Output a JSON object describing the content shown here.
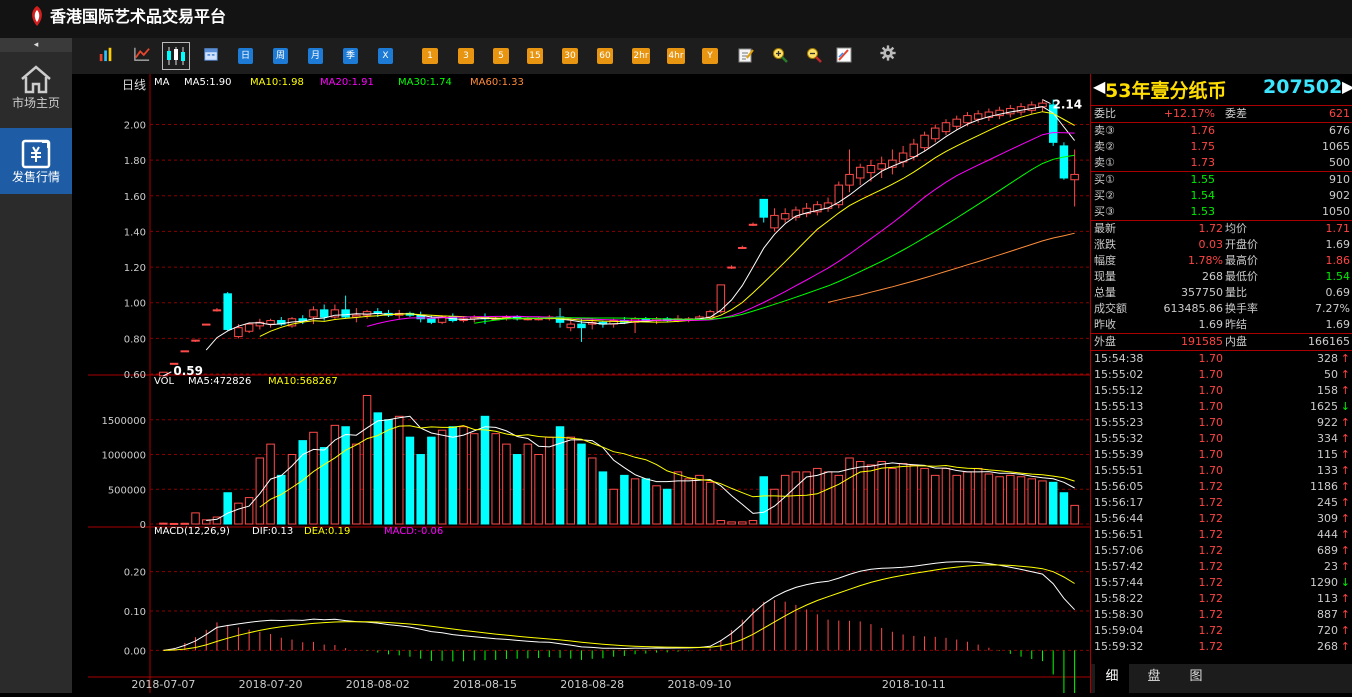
{
  "app": {
    "title": "香港国际艺术品交易平台"
  },
  "sidebar": {
    "collapse_icon": "◂",
    "items": [
      {
        "label": "市场主页",
        "icon": "home-icon"
      },
      {
        "label": "发售行情",
        "icon": "trade-icon"
      }
    ]
  },
  "toolbar": {
    "icons": [
      "bar-chart-icon",
      "line-chart-icon",
      "candlestick-icon",
      "calendar-icon"
    ],
    "periods": [
      "日",
      "周",
      "月",
      "季",
      "X"
    ],
    "minutes": [
      "1",
      "3",
      "5",
      "15",
      "30",
      "60",
      "2hr",
      "4hr",
      "Y"
    ],
    "tools": [
      "edit-icon",
      "zoom-in-icon",
      "zoom-out-icon",
      "draw-icon",
      "settings-icon"
    ]
  },
  "chart": {
    "kline_label": "日线",
    "ma_label": "MA",
    "ma": [
      {
        "label": "MA5:1.90",
        "color": "#ffffff"
      },
      {
        "label": "MA10:1.98",
        "color": "#ffff00"
      },
      {
        "label": "MA20:1.91",
        "color": "#ff00ff"
      },
      {
        "label": "MA30:1.74",
        "color": "#00ff00"
      },
      {
        "label": "MA60:1.33",
        "color": "#ff8c3a"
      }
    ],
    "vol_label": "VOL",
    "vol_ma": [
      {
        "label": "MA5:472826",
        "color": "#ffffff"
      },
      {
        "label": "MA10:568267",
        "color": "#ffff00"
      }
    ],
    "macd_label": "MACD(12,26,9)",
    "macd_items": [
      {
        "label": "DIF:0.13",
        "color": "#ffffff"
      },
      {
        "label": "DEA:0.19",
        "color": "#ffff00"
      },
      {
        "label": "MACD:-0.06",
        "color": "#ff00ff"
      }
    ],
    "price_ticks": [
      "2.00",
      "1.80",
      "1.60",
      "1.40",
      "1.20",
      "1.00",
      "0.80",
      "0.60"
    ],
    "vol_ticks": [
      "1500000",
      "1000000",
      "500000",
      "0"
    ],
    "macd_ticks": [
      "0.20",
      "0.10",
      "0.00"
    ],
    "high_label": "2.14",
    "low_label": "0.59",
    "date_labels": [
      "2018-07-07",
      "2018-07-20",
      "2018-08-02",
      "2018-08-15",
      "2018-08-28",
      "2018-09-10",
      "2018-10-11"
    ]
  },
  "chart_data": {
    "type": "candlestick",
    "title": "日线",
    "ylim": [
      0.6,
      2.16
    ],
    "candles": [
      {
        "o": 0.59,
        "h": 0.61,
        "l": 0.59,
        "c": 0.61,
        "v": 12000
      },
      {
        "o": 0.66,
        "h": 0.66,
        "l": 0.66,
        "c": 0.66,
        "v": 8000
      },
      {
        "o": 0.73,
        "h": 0.73,
        "l": 0.73,
        "c": 0.73,
        "v": 10000
      },
      {
        "o": 0.79,
        "h": 0.79,
        "l": 0.78,
        "c": 0.79,
        "v": 160000
      },
      {
        "o": 0.88,
        "h": 0.88,
        "l": 0.88,
        "c": 0.88,
        "v": 60000
      },
      {
        "o": 0.96,
        "h": 0.97,
        "l": 0.95,
        "c": 0.96,
        "v": 100000
      },
      {
        "o": 1.05,
        "h": 1.06,
        "l": 0.84,
        "c": 0.85,
        "v": 450000
      },
      {
        "o": 0.81,
        "h": 0.88,
        "l": 0.8,
        "c": 0.86,
        "v": 300000
      },
      {
        "o": 0.84,
        "h": 0.89,
        "l": 0.83,
        "c": 0.88,
        "v": 380000
      },
      {
        "o": 0.87,
        "h": 0.91,
        "l": 0.85,
        "c": 0.89,
        "v": 950000
      },
      {
        "o": 0.88,
        "h": 0.91,
        "l": 0.86,
        "c": 0.9,
        "v": 1150000
      },
      {
        "o": 0.9,
        "h": 0.92,
        "l": 0.87,
        "c": 0.88,
        "v": 700000
      },
      {
        "o": 0.87,
        "h": 0.92,
        "l": 0.86,
        "c": 0.91,
        "v": 1000000
      },
      {
        "o": 0.91,
        "h": 0.93,
        "l": 0.88,
        "c": 0.9,
        "v": 1200000
      },
      {
        "o": 0.92,
        "h": 0.98,
        "l": 0.88,
        "c": 0.96,
        "v": 1320000
      },
      {
        "o": 0.96,
        "h": 0.99,
        "l": 0.9,
        "c": 0.92,
        "v": 1100000
      },
      {
        "o": 0.92,
        "h": 0.99,
        "l": 0.91,
        "c": 0.96,
        "v": 1420000
      },
      {
        "o": 0.96,
        "h": 1.04,
        "l": 0.91,
        "c": 0.92,
        "v": 1400000
      },
      {
        "o": 0.92,
        "h": 0.97,
        "l": 0.89,
        "c": 0.93,
        "v": 1150000
      },
      {
        "o": 0.93,
        "h": 0.96,
        "l": 0.91,
        "c": 0.95,
        "v": 1850000
      },
      {
        "o": 0.95,
        "h": 0.97,
        "l": 0.92,
        "c": 0.94,
        "v": 1600000
      },
      {
        "o": 0.94,
        "h": 0.96,
        "l": 0.92,
        "c": 0.93,
        "v": 1500000
      },
      {
        "o": 0.93,
        "h": 0.96,
        "l": 0.91,
        "c": 0.94,
        "v": 1550000
      },
      {
        "o": 0.94,
        "h": 0.95,
        "l": 0.92,
        "c": 0.93,
        "v": 1250000
      },
      {
        "o": 0.93,
        "h": 0.95,
        "l": 0.89,
        "c": 0.91,
        "v": 1000000
      },
      {
        "o": 0.91,
        "h": 0.93,
        "l": 0.88,
        "c": 0.89,
        "v": 1250000
      },
      {
        "o": 0.89,
        "h": 0.93,
        "l": 0.88,
        "c": 0.92,
        "v": 1350000
      },
      {
        "o": 0.92,
        "h": 0.94,
        "l": 0.89,
        "c": 0.9,
        "v": 1400000
      },
      {
        "o": 0.9,
        "h": 0.92,
        "l": 0.89,
        "c": 0.91,
        "v": 1400000
      },
      {
        "o": 0.91,
        "h": 0.93,
        "l": 0.89,
        "c": 0.92,
        "v": 1300000
      },
      {
        "o": 0.92,
        "h": 0.94,
        "l": 0.88,
        "c": 0.91,
        "v": 1550000
      },
      {
        "o": 0.91,
        "h": 0.92,
        "l": 0.9,
        "c": 0.91,
        "v": 1300000
      },
      {
        "o": 0.91,
        "h": 0.93,
        "l": 0.9,
        "c": 0.92,
        "v": 1150000
      },
      {
        "o": 0.92,
        "h": 0.93,
        "l": 0.9,
        "c": 0.91,
        "v": 1000000
      },
      {
        "o": 0.91,
        "h": 0.92,
        "l": 0.9,
        "c": 0.91,
        "v": 1150000
      },
      {
        "o": 0.91,
        "h": 0.92,
        "l": 0.9,
        "c": 0.91,
        "v": 1000000
      },
      {
        "o": 0.91,
        "h": 0.93,
        "l": 0.9,
        "c": 0.92,
        "v": 1250000
      },
      {
        "o": 0.92,
        "h": 0.97,
        "l": 0.86,
        "c": 0.89,
        "v": 1400000
      },
      {
        "o": 0.86,
        "h": 0.91,
        "l": 0.84,
        "c": 0.88,
        "v": 1250000
      },
      {
        "o": 0.88,
        "h": 0.91,
        "l": 0.78,
        "c": 0.86,
        "v": 1150000
      },
      {
        "o": 0.88,
        "h": 0.91,
        "l": 0.85,
        "c": 0.89,
        "v": 950000
      },
      {
        "o": 0.89,
        "h": 0.9,
        "l": 0.86,
        "c": 0.88,
        "v": 750000
      },
      {
        "o": 0.88,
        "h": 0.91,
        "l": 0.86,
        "c": 0.9,
        "v": 500000
      },
      {
        "o": 0.9,
        "h": 0.92,
        "l": 0.88,
        "c": 0.89,
        "v": 700000
      },
      {
        "o": 0.89,
        "h": 0.92,
        "l": 0.83,
        "c": 0.91,
        "v": 650000
      },
      {
        "o": 0.91,
        "h": 0.92,
        "l": 0.89,
        "c": 0.9,
        "v": 650000
      },
      {
        "o": 0.9,
        "h": 0.92,
        "l": 0.88,
        "c": 0.91,
        "v": 550000
      },
      {
        "o": 0.91,
        "h": 0.92,
        "l": 0.89,
        "c": 0.9,
        "v": 500000
      },
      {
        "o": 0.9,
        "h": 0.93,
        "l": 0.89,
        "c": 0.91,
        "v": 750000
      },
      {
        "o": 0.91,
        "h": 0.92,
        "l": 0.89,
        "c": 0.91,
        "v": 650000
      },
      {
        "o": 0.91,
        "h": 0.93,
        "l": 0.9,
        "c": 0.92,
        "v": 700000
      },
      {
        "o": 0.92,
        "h": 0.96,
        "l": 0.91,
        "c": 0.95,
        "v": 600000
      },
      {
        "o": 0.95,
        "h": 1.1,
        "l": 0.94,
        "c": 1.1,
        "v": 50000
      },
      {
        "o": 1.2,
        "h": 1.21,
        "l": 1.19,
        "c": 1.2,
        "v": 30000
      },
      {
        "o": 1.31,
        "h": 1.32,
        "l": 1.31,
        "c": 1.31,
        "v": 30000
      },
      {
        "o": 1.44,
        "h": 1.45,
        "l": 1.43,
        "c": 1.44,
        "v": 50000
      },
      {
        "o": 1.58,
        "h": 1.58,
        "l": 1.45,
        "c": 1.48,
        "v": 680000
      },
      {
        "o": 1.42,
        "h": 1.53,
        "l": 1.4,
        "c": 1.49,
        "v": 500000
      },
      {
        "o": 1.47,
        "h": 1.53,
        "l": 1.45,
        "c": 1.5,
        "v": 700000
      },
      {
        "o": 1.48,
        "h": 1.54,
        "l": 1.46,
        "c": 1.52,
        "v": 750000
      },
      {
        "o": 1.5,
        "h": 1.56,
        "l": 1.48,
        "c": 1.53,
        "v": 750000
      },
      {
        "o": 1.51,
        "h": 1.57,
        "l": 1.49,
        "c": 1.55,
        "v": 800000
      },
      {
        "o": 1.53,
        "h": 1.59,
        "l": 1.51,
        "c": 1.56,
        "v": 750000
      },
      {
        "o": 1.55,
        "h": 1.68,
        "l": 1.53,
        "c": 1.66,
        "v": 700000
      },
      {
        "o": 1.66,
        "h": 1.86,
        "l": 1.62,
        "c": 1.72,
        "v": 950000
      },
      {
        "o": 1.7,
        "h": 1.78,
        "l": 1.66,
        "c": 1.76,
        "v": 900000
      },
      {
        "o": 1.73,
        "h": 1.8,
        "l": 1.68,
        "c": 1.77,
        "v": 850000
      },
      {
        "o": 1.75,
        "h": 1.82,
        "l": 1.7,
        "c": 1.78,
        "v": 900000
      },
      {
        "o": 1.76,
        "h": 1.86,
        "l": 1.72,
        "c": 1.8,
        "v": 800000
      },
      {
        "o": 1.79,
        "h": 1.88,
        "l": 1.76,
        "c": 1.84,
        "v": 870000
      },
      {
        "o": 1.82,
        "h": 1.92,
        "l": 1.8,
        "c": 1.89,
        "v": 850000
      },
      {
        "o": 1.87,
        "h": 1.96,
        "l": 1.85,
        "c": 1.94,
        "v": 800000
      },
      {
        "o": 1.92,
        "h": 2.0,
        "l": 1.9,
        "c": 1.98,
        "v": 700000
      },
      {
        "o": 1.96,
        "h": 2.03,
        "l": 1.94,
        "c": 2.01,
        "v": 800000
      },
      {
        "o": 1.99,
        "h": 2.05,
        "l": 1.97,
        "c": 2.03,
        "v": 700000
      },
      {
        "o": 2.01,
        "h": 2.07,
        "l": 1.99,
        "c": 2.05,
        "v": 750000
      },
      {
        "o": 2.03,
        "h": 2.08,
        "l": 2.01,
        "c": 2.06,
        "v": 800000
      },
      {
        "o": 2.04,
        "h": 2.09,
        "l": 2.02,
        "c": 2.07,
        "v": 720000
      },
      {
        "o": 2.05,
        "h": 2.1,
        "l": 2.03,
        "c": 2.08,
        "v": 680000
      },
      {
        "o": 2.06,
        "h": 2.11,
        "l": 2.04,
        "c": 2.09,
        "v": 700000
      },
      {
        "o": 2.07,
        "h": 2.12,
        "l": 2.05,
        "c": 2.1,
        "v": 680000
      },
      {
        "o": 2.08,
        "h": 2.13,
        "l": 2.06,
        "c": 2.11,
        "v": 650000
      },
      {
        "o": 2.1,
        "h": 2.14,
        "l": 2.07,
        "c": 2.12,
        "v": 620000
      },
      {
        "o": 2.11,
        "h": 2.14,
        "l": 1.88,
        "c": 1.9,
        "v": 600000
      },
      {
        "o": 1.88,
        "h": 1.9,
        "l": 1.69,
        "c": 1.7,
        "v": 450000
      },
      {
        "o": 1.69,
        "h": 1.86,
        "l": 1.54,
        "c": 1.72,
        "v": 268000
      }
    ],
    "ma5_last": 1.9,
    "ma10_last": 1.98,
    "ma20_last": 1.91,
    "ma30_last": 1.74,
    "ma60_last": 1.33,
    "macd": {
      "dif_last": 0.13,
      "dea_last": 0.19,
      "macd_last": -0.06
    },
    "vol_ma5_last": 472826,
    "vol_ma10_last": 568267
  },
  "stock": {
    "name": "53年壹分纸币",
    "code": "207502"
  },
  "quote": {
    "weibi": {
      "l1": "委比",
      "v1": "+12.17%",
      "l2": "委差",
      "v2": "621"
    },
    "sells": [
      {
        "l": "卖③",
        "p": "1.76",
        "q": "676"
      },
      {
        "l": "卖②",
        "p": "1.75",
        "q": "1065"
      },
      {
        "l": "卖①",
        "p": "1.73",
        "q": "500"
      }
    ],
    "buys": [
      {
        "l": "买①",
        "p": "1.55",
        "q": "910"
      },
      {
        "l": "买②",
        "p": "1.54",
        "q": "902"
      },
      {
        "l": "买③",
        "p": "1.53",
        "q": "1050"
      }
    ],
    "stats": [
      {
        "l1": "最新",
        "v1": "1.72",
        "c1": "#ff4444",
        "l2": "均价",
        "v2": "1.71",
        "c2": "#ff4444"
      },
      {
        "l1": "涨跌",
        "v1": "0.03",
        "c1": "#ff4444",
        "l2": "开盘价",
        "v2": "1.69",
        "c2": "#cccccc"
      },
      {
        "l1": "幅度",
        "v1": "1.78%",
        "c1": "#ff4444",
        "l2": "最高价",
        "v2": "1.86",
        "c2": "#ff4444"
      },
      {
        "l1": "现量",
        "v1": "268",
        "c1": "#cccccc",
        "l2": "最低价",
        "v2": "1.54",
        "c2": "#00ee00"
      },
      {
        "l1": "总量",
        "v1": "357750",
        "c1": "#cccccc",
        "l2": "量比",
        "v2": "0.69",
        "c2": "#cccccc"
      },
      {
        "l1": "成交额",
        "v1": "613485.86",
        "c1": "#cccccc",
        "l2": "换手率",
        "v2": "7.27%",
        "c2": "#cccccc"
      },
      {
        "l1": "昨收",
        "v1": "1.69",
        "c1": "#cccccc",
        "l2": "昨结",
        "v2": "1.69",
        "c2": "#cccccc"
      }
    ],
    "outer": {
      "l1": "外盘",
      "v1": "191585",
      "l2": "内盘",
      "v2": "166165"
    }
  },
  "ticks": [
    {
      "t": "15:54:38",
      "p": "1.70",
      "q": "328",
      "d": "↑"
    },
    {
      "t": "15:55:02",
      "p": "1.70",
      "q": "50",
      "d": "↑"
    },
    {
      "t": "15:55:12",
      "p": "1.70",
      "q": "158",
      "d": "↑"
    },
    {
      "t": "15:55:13",
      "p": "1.70",
      "q": "1625",
      "d": "↓"
    },
    {
      "t": "15:55:23",
      "p": "1.70",
      "q": "922",
      "d": "↑"
    },
    {
      "t": "15:55:32",
      "p": "1.70",
      "q": "334",
      "d": "↑"
    },
    {
      "t": "15:55:39",
      "p": "1.70",
      "q": "115",
      "d": "↑"
    },
    {
      "t": "15:55:51",
      "p": "1.70",
      "q": "133",
      "d": "↑"
    },
    {
      "t": "15:56:05",
      "p": "1.72",
      "q": "1186",
      "d": "↑"
    },
    {
      "t": "15:56:17",
      "p": "1.72",
      "q": "245",
      "d": "↑"
    },
    {
      "t": "15:56:44",
      "p": "1.72",
      "q": "309",
      "d": "↑"
    },
    {
      "t": "15:56:51",
      "p": "1.72",
      "q": "444",
      "d": "↑"
    },
    {
      "t": "15:57:06",
      "p": "1.72",
      "q": "689",
      "d": "↑"
    },
    {
      "t": "15:57:42",
      "p": "1.72",
      "q": "23",
      "d": "↑"
    },
    {
      "t": "15:57:44",
      "p": "1.72",
      "q": "1290",
      "d": "↓"
    },
    {
      "t": "15:58:22",
      "p": "1.72",
      "q": "113",
      "d": "↑"
    },
    {
      "t": "15:58:30",
      "p": "1.72",
      "q": "887",
      "d": "↑"
    },
    {
      "t": "15:59:04",
      "p": "1.72",
      "q": "720",
      "d": "↑"
    },
    {
      "t": "15:59:32",
      "p": "1.72",
      "q": "268",
      "d": "↑"
    }
  ],
  "tabs": [
    "细",
    "盘",
    "图"
  ]
}
